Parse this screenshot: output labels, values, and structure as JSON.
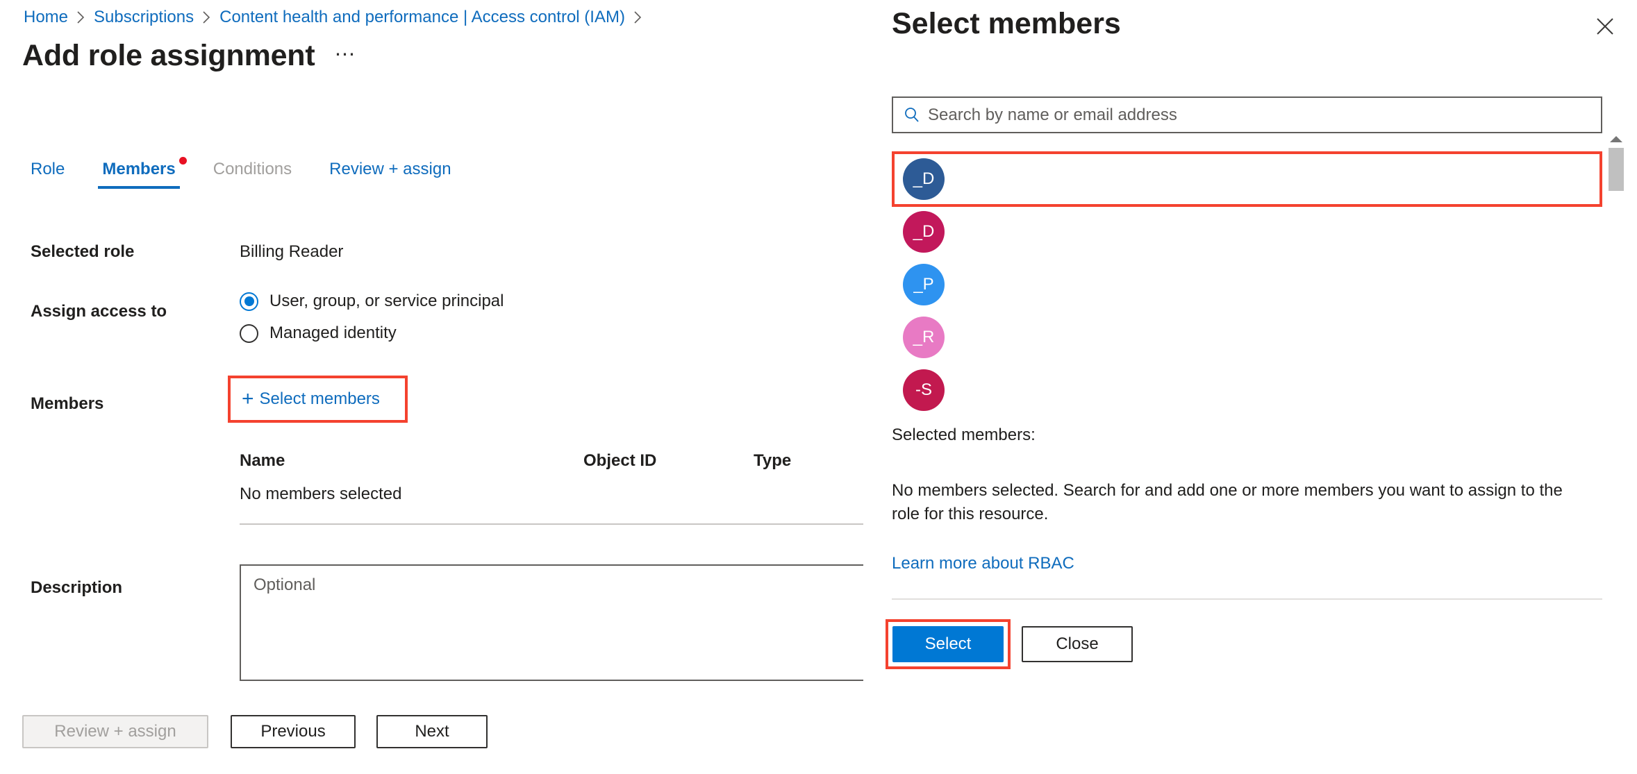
{
  "breadcrumb": {
    "items": [
      {
        "label": "Home"
      },
      {
        "label": "Subscriptions"
      },
      {
        "label": "Content health and performance | Access control (IAM)"
      }
    ],
    "separator_icon": "chevron-right-icon"
  },
  "header": {
    "title": "Add role assignment",
    "more_label": "⋯"
  },
  "tabs": [
    {
      "label": "Role",
      "state": "enabled"
    },
    {
      "label": "Members",
      "state": "active"
    },
    {
      "label": "Conditions",
      "state": "disabled"
    },
    {
      "label": "Review + assign",
      "state": "enabled"
    }
  ],
  "form": {
    "selected_role_label": "Selected role",
    "selected_role_value": "Billing Reader",
    "assign_access_label": "Assign access to",
    "radios": [
      {
        "label": "User, group, or service principal",
        "checked": true
      },
      {
        "label": "Managed identity",
        "checked": false
      }
    ],
    "members_label": "Members",
    "select_members_button": "Select members",
    "plus_icon": "plus-icon",
    "table": {
      "columns": [
        "Name",
        "Object ID",
        "Type"
      ],
      "rows": [
        [
          "No members selected",
          "",
          ""
        ]
      ]
    },
    "description_label": "Description",
    "description_value": "",
    "description_placeholder": "Optional"
  },
  "footer": {
    "review_assign": "Review + assign",
    "previous": "Previous",
    "next": "Next"
  },
  "flyout": {
    "title": "Select members",
    "close_icon": "close-icon",
    "search": {
      "icon": "search-icon",
      "value": "",
      "placeholder": "Search by name or email address"
    },
    "member_list": [
      {
        "initials": "_D",
        "color": "#2d5b96",
        "name": "",
        "highlighted": true
      },
      {
        "initials": "_D",
        "color": "#c2185b",
        "name": "",
        "highlighted": false
      },
      {
        "initials": "_P",
        "color": "#2e93f0",
        "name": "",
        "highlighted": false
      },
      {
        "initials": "_R",
        "color": "#e87ac4",
        "name": "",
        "highlighted": false
      },
      {
        "initials": "-S",
        "color": "#c2194f",
        "name": "",
        "highlighted": false
      }
    ],
    "scrollbar": {
      "up_arrow_icon": "scroll-up-arrow-icon"
    },
    "selected_members_label": "Selected members:",
    "selected_members_empty": "No members selected. Search for and add one or more members you want to assign to the role for this resource.",
    "learn_more": "Learn more about RBAC",
    "select_button": "Select",
    "close_button": "Close"
  },
  "colors": {
    "accent": "#0078d4",
    "link": "#0f6cbd",
    "annotation": "#f4422f",
    "tab_dot": "#e81123"
  }
}
